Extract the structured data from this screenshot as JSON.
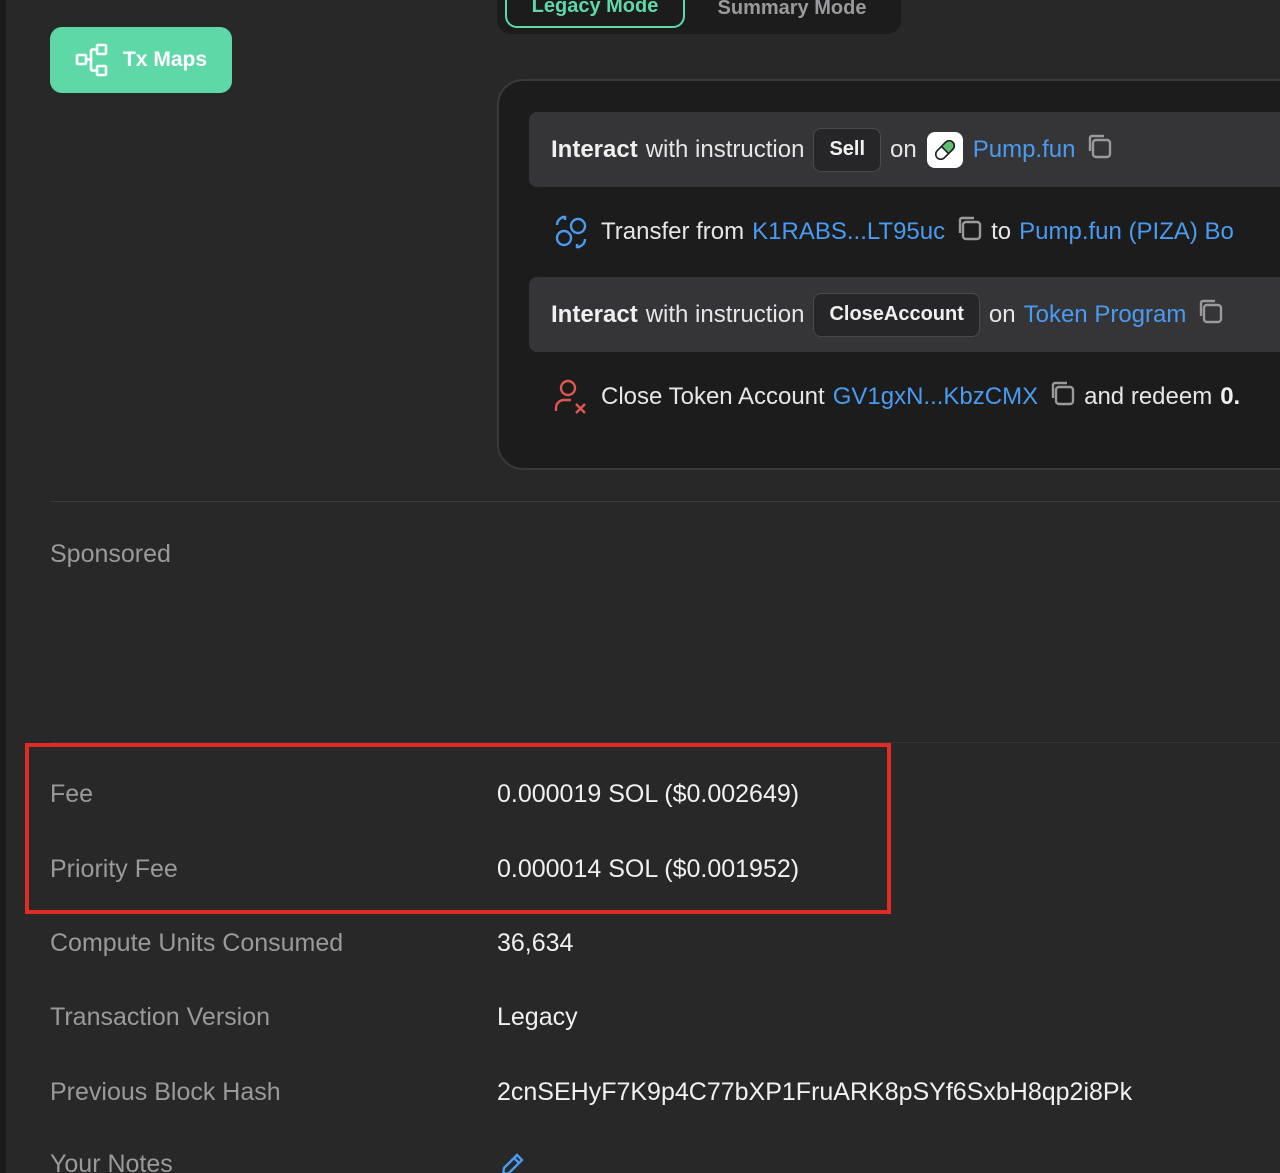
{
  "toolbar": {
    "tx_maps_label": "Tx Maps"
  },
  "mode_tabs": {
    "legacy_label": "Legacy Mode",
    "summary_label": "Summary Mode"
  },
  "instructions": [
    {
      "lead": "Interact",
      "text": "with instruction",
      "instruction_name": "Sell",
      "on": "on",
      "program": "Pump.fun"
    },
    {
      "text": "Transfer from",
      "from": "K1RABS...LT95uc",
      "to_word": "to",
      "to": "Pump.fun (PIZA) Bo"
    },
    {
      "lead": "Interact",
      "text": "with instruction",
      "instruction_name": "CloseAccount",
      "on": "on",
      "program": "Token Program"
    },
    {
      "text": "Close Token Account",
      "account": "GV1gxN...KbzCMX",
      "tail": "and redeem",
      "tail_value": "0."
    }
  ],
  "sponsored_label": "Sponsored",
  "details": {
    "fee": {
      "label": "Fee",
      "value": "0.000019 SOL ($0.002649)"
    },
    "priority_fee": {
      "label": "Priority Fee",
      "value": "0.000014 SOL ($0.001952)"
    },
    "compute_units": {
      "label": "Compute Units Consumed",
      "value": "36,634"
    },
    "tx_version": {
      "label": "Transaction Version",
      "value": "Legacy"
    },
    "prev_block_hash": {
      "label": "Previous Block Hash",
      "value": "2cnSEHyF7K9p4C77bXP1FruARK8pSYf6SxbH8qp2i8Pk"
    },
    "notes": {
      "label": "Your Notes"
    }
  },
  "colors": {
    "accent": "#5fd8a8",
    "link": "#4a9bf0",
    "highlight": "#e02c25",
    "background": "#282829"
  },
  "icons": [
    "flow-map-icon",
    "copy-icon",
    "transfer-icon",
    "close-account-icon",
    "pump-fun-pill-icon",
    "edit-pencil-icon"
  ]
}
